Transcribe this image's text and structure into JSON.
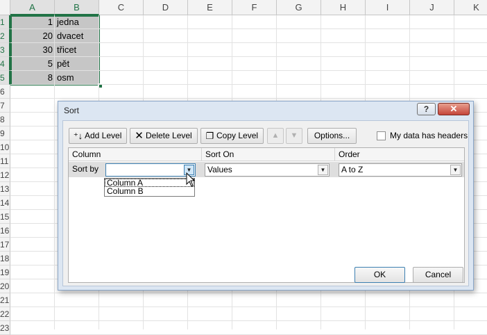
{
  "sheet": {
    "columns": [
      "A",
      "B",
      "C",
      "D",
      "E",
      "F",
      "G",
      "H",
      "I",
      "J",
      "K"
    ],
    "rows": [
      "1",
      "2",
      "3",
      "4",
      "5",
      "6",
      "7",
      "8",
      "9",
      "10",
      "11",
      "12",
      "13",
      "14",
      "15",
      "16",
      "17",
      "18",
      "19",
      "20",
      "21",
      "22",
      "23"
    ],
    "data": [
      {
        "a": "1",
        "b": "jedna"
      },
      {
        "a": "20",
        "b": "dvacet"
      },
      {
        "a": "30",
        "b": "třicet"
      },
      {
        "a": "5",
        "b": "pět"
      },
      {
        "a": "8",
        "b": "osm"
      }
    ]
  },
  "dialog": {
    "title": "Sort",
    "help_label": "?",
    "close_label": "✕",
    "add_level": "Add Level",
    "delete_level": "Delete Level",
    "copy_level": "Copy Level",
    "options": "Options...",
    "move_up": "▲",
    "move_down": "▼",
    "headers_checkbox": "My data has headers",
    "columns": {
      "column": "Column",
      "sort_on": "Sort On",
      "order": "Order"
    },
    "row": {
      "label": "Sort by",
      "column_value": "",
      "sort_on_value": "Values",
      "order_value": "A to Z"
    },
    "dropdown_options": [
      "Column A",
      "Column B"
    ],
    "ok": "OK",
    "cancel": "Cancel"
  }
}
